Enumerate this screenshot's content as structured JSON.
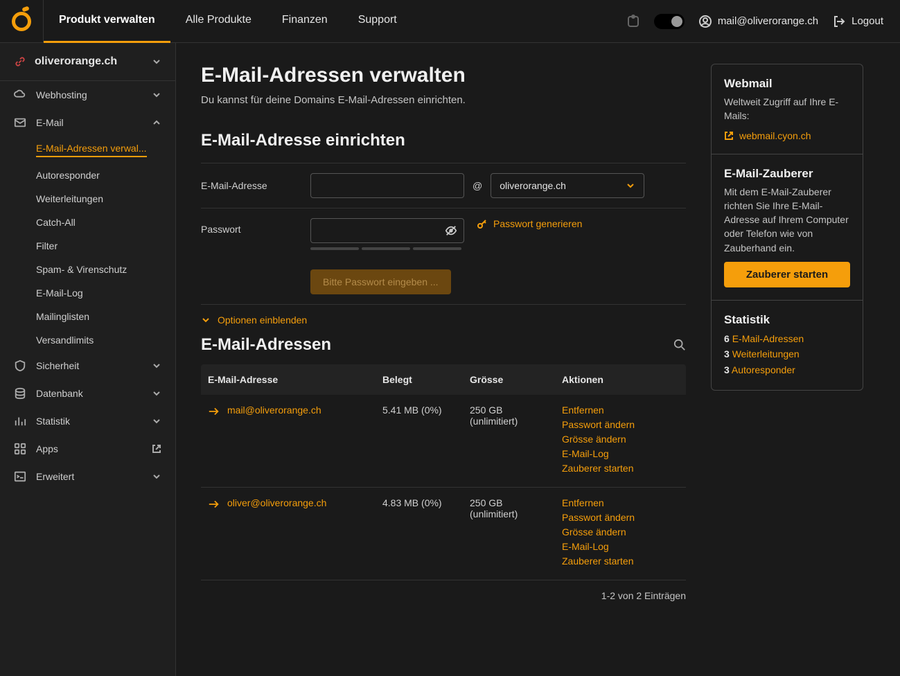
{
  "header": {
    "nav": [
      "Produkt verwalten",
      "Alle Produkte",
      "Finanzen",
      "Support"
    ],
    "user": "mail@oliverorange.ch",
    "logout": "Logout"
  },
  "sidebar": {
    "domain": "oliverorange.ch",
    "items": [
      {
        "label": "Webhosting",
        "icon": "cloud",
        "expand": true
      },
      {
        "label": "E-Mail",
        "icon": "mail",
        "expand": true,
        "open": true,
        "children": [
          {
            "label": "E-Mail-Adressen verwal...",
            "active": true
          },
          {
            "label": "Autoresponder"
          },
          {
            "label": "Weiterleitungen"
          },
          {
            "label": "Catch-All"
          },
          {
            "label": "Filter"
          },
          {
            "label": "Spam- & Virenschutz"
          },
          {
            "label": "E-Mail-Log"
          },
          {
            "label": "Mailinglisten"
          },
          {
            "label": "Versandlimits"
          }
        ]
      },
      {
        "label": "Sicherheit",
        "icon": "shield",
        "expand": true
      },
      {
        "label": "Datenbank",
        "icon": "database",
        "expand": true
      },
      {
        "label": "Statistik",
        "icon": "chart",
        "expand": true
      },
      {
        "label": "Apps",
        "icon": "apps",
        "external": true
      },
      {
        "label": "Erweitert",
        "icon": "terminal",
        "expand": true
      }
    ]
  },
  "main": {
    "title": "E-Mail-Adressen verwalten",
    "subtitle": "Du kannst für deine Domains E-Mail-Adressen einrichten.",
    "setup_heading": "E-Mail-Adresse einrichten",
    "email_label": "E-Mail-Adresse",
    "at": "@",
    "domain_selected": "oliverorange.ch",
    "pwd_label": "Passwort",
    "pwd_generate": "Passwort generieren",
    "btn_submit": "Bitte Passwort eingeben ...",
    "options_toggle": "Optionen einblenden",
    "list_heading": "E-Mail-Adressen",
    "columns": {
      "email": "E-Mail-Adresse",
      "used": "Belegt",
      "size": "Grösse",
      "actions": "Aktionen"
    },
    "rows": [
      {
        "email": "mail@oliverorange.ch",
        "used": "5.41 MB (0%)",
        "size": "250 GB",
        "size_note": "(unlimitiert)"
      },
      {
        "email": "oliver@oliverorange.ch",
        "used": "4.83 MB (0%)",
        "size": "250 GB",
        "size_note": "(unlimitiert)"
      }
    ],
    "row_actions": [
      "Entfernen",
      "Passwort ändern",
      "Grösse ändern",
      "E-Mail-Log",
      "Zauberer starten"
    ],
    "pager": "1-2 von 2 Einträgen"
  },
  "aside": {
    "webmail": {
      "title": "Webmail",
      "text": "Weltweit Zugriff auf Ihre E-Mails:",
      "link": "webmail.cyon.ch"
    },
    "wizard": {
      "title": "E-Mail-Zauberer",
      "text": "Mit dem E-Mail-Zauberer richten Sie Ihre E-Mail-Adresse auf Ihrem Computer oder Telefon wie von Zauberhand ein.",
      "button": "Zauberer starten"
    },
    "stats": {
      "title": "Statistik",
      "lines": [
        {
          "count": "6",
          "label": "E-Mail-Adressen"
        },
        {
          "count": "3",
          "label": "Weiterleitungen"
        },
        {
          "count": "3",
          "label": "Autoresponder"
        }
      ]
    }
  }
}
